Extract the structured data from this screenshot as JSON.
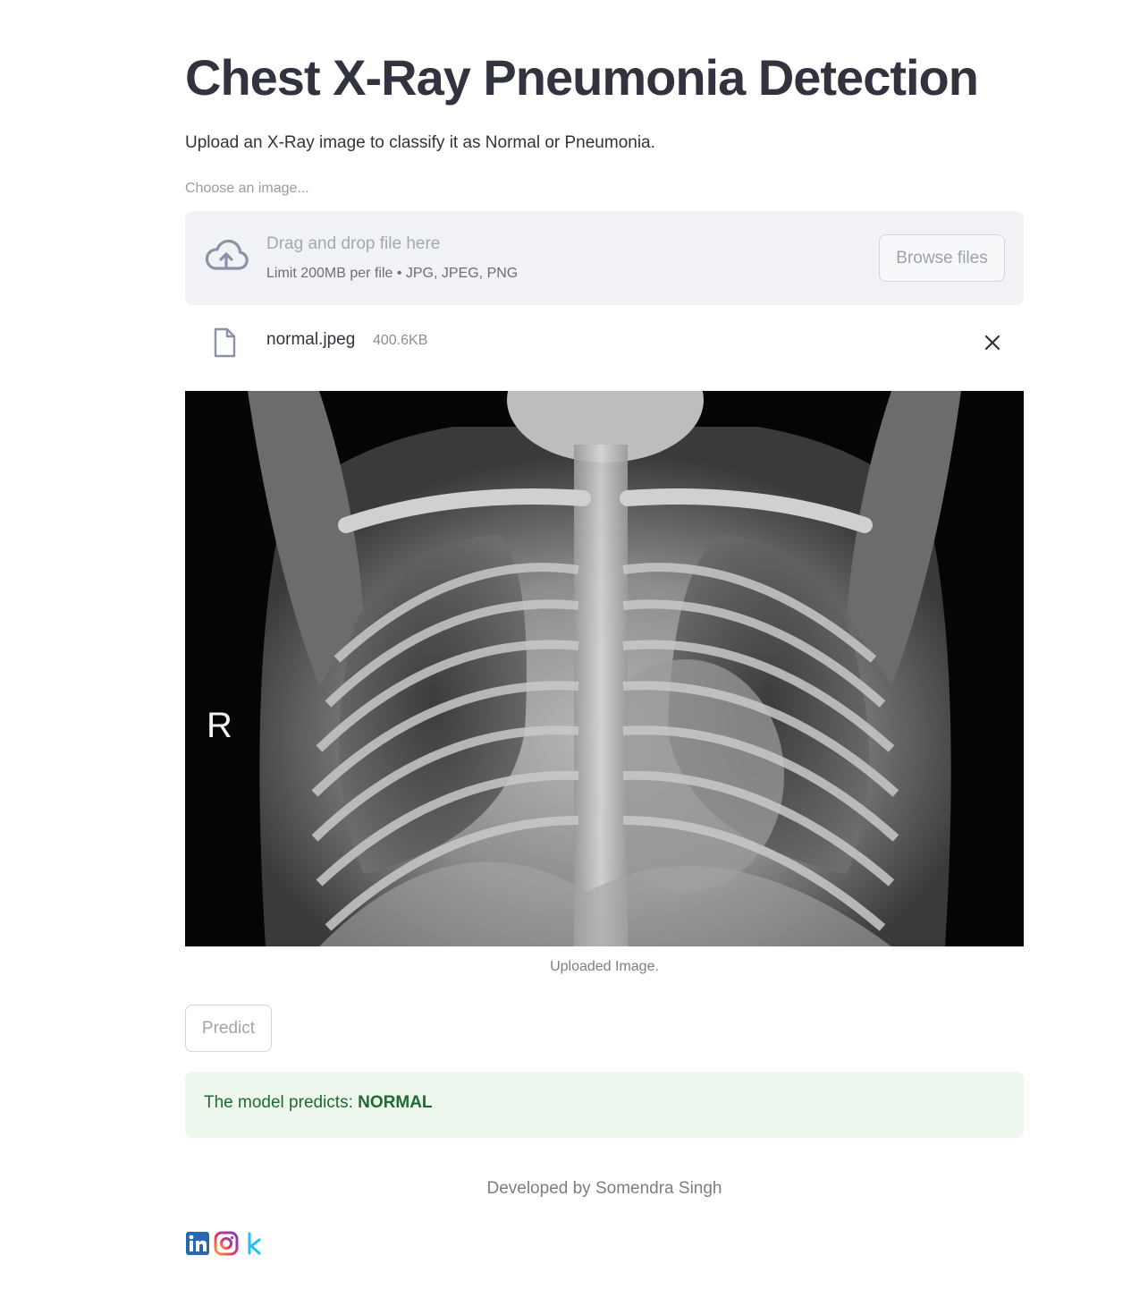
{
  "page": {
    "title": "Chest X-Ray Pneumonia Detection",
    "subtitle": "Upload an X-Ray image to classify it as Normal or Pneumonia."
  },
  "uploader": {
    "label": "Choose an image...",
    "drop_title": "Drag and drop file here",
    "limit_text": "Limit 200MB per file • JPG, JPEG, PNG",
    "browse_label": "Browse files",
    "upload_icon": "cloud-upload-icon"
  },
  "uploaded_file": {
    "name": "normal.jpeg",
    "size": "400.6KB",
    "file_icon": "file-icon",
    "remove_icon": "close-icon"
  },
  "image": {
    "marker_letter": "R",
    "caption": "Uploaded Image."
  },
  "predict": {
    "label": "Predict"
  },
  "result": {
    "prefix": "The model predicts: ",
    "value": "NORMAL",
    "color": "#1e6b2e",
    "background": "#eef7ee"
  },
  "footer": {
    "text": "Developed by Somendra Singh",
    "social_icons": [
      "linkedin-icon",
      "instagram-icon",
      "kaggle-icon"
    ]
  }
}
